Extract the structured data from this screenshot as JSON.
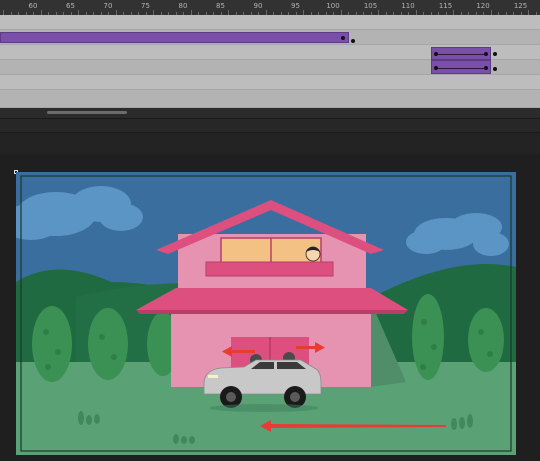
{
  "timeline": {
    "ruler_labels": [
      "60",
      "65",
      "70",
      "75",
      "80",
      "85",
      "90",
      "95",
      "100",
      "105",
      "110",
      "115",
      "120",
      "125"
    ]
  },
  "colors": {
    "sky": "#3a6e9e",
    "cloud": "#5b95c6",
    "hill_dark": "#1f6a40",
    "grass": "#5aa276",
    "house_wall": "#e593b0",
    "roof": "#dd4f7e",
    "window": "#f4c184",
    "motion_arrow": "#e83b36",
    "layer_span": "#7a4fa9"
  },
  "icons": {
    "registration": "registration-point-icon"
  }
}
